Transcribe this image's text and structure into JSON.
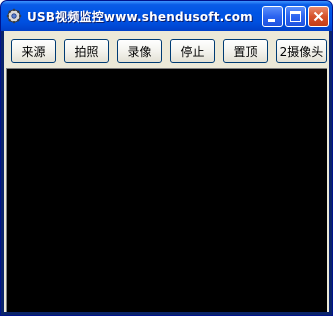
{
  "window": {
    "title": "USB视频监控www.shendusoft.com",
    "app_icon": "gear-icon",
    "controls": {
      "minimize_icon": "minimize-icon",
      "maximize_icon": "maximize-icon",
      "close_icon": "close-icon"
    }
  },
  "toolbar": {
    "buttons": [
      {
        "label": "来源"
      },
      {
        "label": "拍照"
      },
      {
        "label": "录像"
      },
      {
        "label": "停止"
      },
      {
        "label": "置顶"
      },
      {
        "label": "2摄像头"
      }
    ]
  },
  "colors": {
    "titlebar": "#0055e5",
    "client_background": "#ece9d8",
    "video_background": "#000000",
    "close_button": "#d6522c"
  }
}
